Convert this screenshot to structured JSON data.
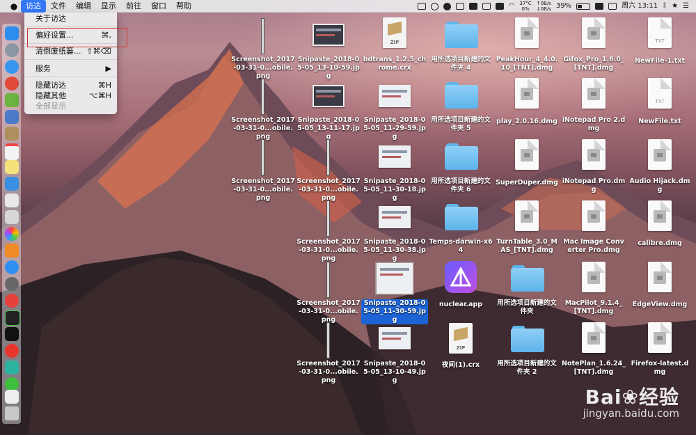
{
  "menubar": {
    "app_name": "访达",
    "menus": [
      "文件",
      "编辑",
      "显示",
      "前往",
      "窗口",
      "帮助"
    ],
    "temperature": "37°C",
    "cpu": "0%",
    "net_up": "0B/s",
    "net_down": "0B/s",
    "battery": "39%",
    "clock": "周六 13:11"
  },
  "finder_menu": {
    "about": "关于访达",
    "preferences": "偏好设置...",
    "preferences_shortcut": "⌘,",
    "empty_trash": "清倒废纸篓...",
    "empty_trash_shortcut": "⇧⌘⌫",
    "services": "服务",
    "services_arrow": "▶",
    "hide": "隐藏访达",
    "hide_shortcut": "⌘H",
    "hide_others": "隐藏其他",
    "hide_others_shortcut": "⌥⌘H",
    "show_all": "全部显示"
  },
  "desktop": {
    "col1": [
      "Screenshot_2017-03-31-0...obile.png",
      "Screenshot_2017-03-31-0...obile.png",
      "Screenshot_2017-03-31-0...obile.png"
    ],
    "col2": [
      "Snipaste_2018-05-05_13-10-59.jpg",
      "Snipaste_2018-05-05_13-11-17.jpg",
      "Screenshot_2017-03-31-0...obile.png",
      "Screenshot_2017-03-31-0...obile.png",
      "Screenshot_2017-03-31-0...obile.png",
      "Screenshot_2017-03-31-0...obile.png"
    ],
    "col3": [
      "bdtrans_1.2.5_chrome.crx",
      "Snipaste_2018-05-05_11-29-59.jpg",
      "Snipaste_2018-05-05_11-30-18.jpg",
      "Snipaste_2018-05-05_11-30-38.jpg",
      "Snipaste_2018-05-05_11-30-59.jpg",
      "Snipaste_2018-05-05_13-10-49.jpg"
    ],
    "col4": [
      "用所选项目新建的文件夹 4",
      "用所选项目新建的文件夹 5",
      "用所选项目新建的文件夹 6",
      "Temps-darwin-x64",
      "nuclear.app",
      "夜间(1).crx"
    ],
    "col5": [
      "PeakHour_4_4.0.10_[TNT].dmg",
      "play_2.0.16.dmg",
      "SuperDuper.dmg",
      "TurnTable_3.0_MAS_[TNT].dmg",
      "用所选项目新建的文件夹",
      "用所选项目新建的文件夹 2"
    ],
    "col6": [
      "Gifox_Pro_1.6.0_[TNT].dmg",
      "iNotepad Pro 2.dmg",
      "iNotepad Pro.dmg",
      "Mac Image Converter Pro.dmg",
      "MacPilot_9.1.4_[TNT].dmg",
      "NotePlan_1.6.24_[TNT].dmg"
    ],
    "col7": [
      "NewFile-1.txt",
      "NewFile.txt",
      "Audio Hijack.dmg",
      "calibre.dmg",
      "EdgeView.dmg",
      "Firefox-latest.dmg"
    ],
    "zip_tag": "ZIP",
    "txt_tag": "TXT"
  },
  "watermark": {
    "brand": "Bai",
    "brand2": "经验",
    "url": "jingyan.baidu.com"
  },
  "colors": {
    "menu_highlight": "#3478f6",
    "selection": "#1c64d6",
    "annotation_box": "#d0342c"
  }
}
